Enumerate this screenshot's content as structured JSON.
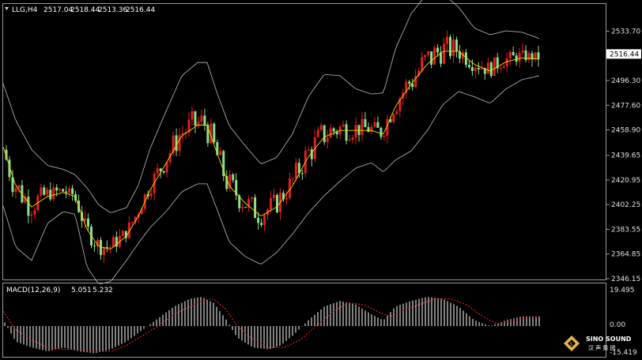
{
  "header": {
    "symbol": "LLG,H4",
    "open": "2517.04",
    "high": "2518.44",
    "low": "2513.36",
    "close": "2516.44"
  },
  "macd": {
    "label": "MACD(12,26,9)",
    "main": "5.051",
    "signal": "5.232",
    "ticks": [
      "19.495",
      "0.00",
      "-15.419"
    ]
  },
  "logo": {
    "name": "SINO SOUND",
    "chinese": "汉 声 集 团"
  },
  "colors": {
    "bull": "#e01f1f",
    "bear": "#8be08b",
    "ma": "#ffd400",
    "band": "#bdbdbd",
    "signal": "#ff2a2a",
    "hist": "#ffffff"
  },
  "chart_data": {
    "type": "candlestick",
    "ylim": [
      2346.15,
      2543.0
    ],
    "yticks": [
      "2533.70",
      "2516.44",
      "2496.30",
      "2477.60",
      "2458.90",
      "2439.65",
      "2420.95",
      "2402.25",
      "2383.55",
      "2364.85",
      "2346.15"
    ],
    "current_price": "2516.44",
    "midline_points": [
      [
        0,
        2455
      ],
      [
        20,
        2418
      ],
      [
        40,
        2402
      ],
      [
        60,
        2410
      ],
      [
        80,
        2413
      ],
      [
        95,
        2410
      ],
      [
        110,
        2385
      ],
      [
        125,
        2372
      ],
      [
        140,
        2370
      ],
      [
        160,
        2380
      ],
      [
        175,
        2395
      ],
      [
        190,
        2415
      ],
      [
        210,
        2435
      ],
      [
        230,
        2456
      ],
      [
        250,
        2464
      ],
      [
        262,
        2464
      ],
      [
        275,
        2442
      ],
      [
        290,
        2418
      ],
      [
        310,
        2405
      ],
      [
        330,
        2395
      ],
      [
        350,
        2402
      ],
      [
        370,
        2418
      ],
      [
        390,
        2440
      ],
      [
        410,
        2455
      ],
      [
        430,
        2460
      ],
      [
        450,
        2460
      ],
      [
        470,
        2460
      ],
      [
        485,
        2457
      ],
      [
        500,
        2478
      ],
      [
        520,
        2495
      ],
      [
        540,
        2510
      ],
      [
        560,
        2520
      ],
      [
        580,
        2520
      ],
      [
        600,
        2510
      ],
      [
        620,
        2505
      ],
      [
        640,
        2512
      ],
      [
        660,
        2515
      ],
      [
        683,
        2514
      ]
    ],
    "band_width_points": [
      [
        0,
        46
      ],
      [
        20,
        48
      ],
      [
        40,
        42
      ],
      [
        60,
        22
      ],
      [
        80,
        16
      ],
      [
        95,
        15
      ],
      [
        110,
        30
      ],
      [
        125,
        30
      ],
      [
        140,
        26
      ],
      [
        160,
        20
      ],
      [
        175,
        22
      ],
      [
        190,
        30
      ],
      [
        210,
        38
      ],
      [
        230,
        44
      ],
      [
        250,
        46
      ],
      [
        262,
        46
      ],
      [
        275,
        44
      ],
      [
        290,
        44
      ],
      [
        310,
        42
      ],
      [
        330,
        38
      ],
      [
        350,
        36
      ],
      [
        370,
        38
      ],
      [
        390,
        44
      ],
      [
        410,
        46
      ],
      [
        430,
        40
      ],
      [
        450,
        30
      ],
      [
        470,
        26
      ],
      [
        485,
        30
      ],
      [
        500,
        42
      ],
      [
        520,
        52
      ],
      [
        540,
        52
      ],
      [
        560,
        42
      ],
      [
        580,
        32
      ],
      [
        600,
        26
      ],
      [
        620,
        26
      ],
      [
        640,
        22
      ],
      [
        660,
        18
      ],
      [
        683,
        14
      ]
    ],
    "ma_offset": -1.5,
    "candle_count": 170,
    "macd_series": {
      "ylim": [
        -15.419,
        19.495
      ],
      "main_points": [
        [
          0,
          6
        ],
        [
          20,
          -8
        ],
        [
          40,
          -11
        ],
        [
          60,
          -13
        ],
        [
          80,
          -11
        ],
        [
          100,
          -13
        ],
        [
          120,
          -14
        ],
        [
          140,
          -12
        ],
        [
          160,
          -8
        ],
        [
          180,
          -2
        ],
        [
          200,
          4
        ],
        [
          220,
          10
        ],
        [
          240,
          14
        ],
        [
          255,
          15
        ],
        [
          270,
          12
        ],
        [
          285,
          4
        ],
        [
          300,
          -6
        ],
        [
          320,
          -11
        ],
        [
          340,
          -12
        ],
        [
          355,
          -10
        ],
        [
          370,
          -5
        ],
        [
          390,
          3
        ],
        [
          410,
          10
        ],
        [
          430,
          13
        ],
        [
          450,
          11
        ],
        [
          470,
          6
        ],
        [
          485,
          3
        ],
        [
          500,
          10
        ],
        [
          520,
          13
        ],
        [
          540,
          15
        ],
        [
          560,
          14
        ],
        [
          580,
          10
        ],
        [
          600,
          3
        ],
        [
          620,
          0
        ],
        [
          640,
          3
        ],
        [
          660,
          5
        ],
        [
          683,
          5
        ]
      ],
      "signal_points": [
        [
          0,
          10
        ],
        [
          20,
          -2
        ],
        [
          40,
          -7
        ],
        [
          60,
          -11
        ],
        [
          80,
          -12
        ],
        [
          100,
          -12
        ],
        [
          120,
          -13
        ],
        [
          140,
          -13
        ],
        [
          160,
          -10
        ],
        [
          180,
          -5
        ],
        [
          200,
          0
        ],
        [
          220,
          6
        ],
        [
          240,
          10
        ],
        [
          255,
          13
        ],
        [
          270,
          14
        ],
        [
          285,
          9
        ],
        [
          300,
          0
        ],
        [
          320,
          -7
        ],
        [
          340,
          -11
        ],
        [
          360,
          -11
        ],
        [
          380,
          -7
        ],
        [
          400,
          0
        ],
        [
          420,
          7
        ],
        [
          440,
          12
        ],
        [
          460,
          11
        ],
        [
          480,
          7
        ],
        [
          495,
          5
        ],
        [
          510,
          8
        ],
        [
          530,
          11
        ],
        [
          550,
          14
        ],
        [
          570,
          14
        ],
        [
          590,
          11
        ],
        [
          610,
          5
        ],
        [
          630,
          1
        ],
        [
          650,
          3
        ],
        [
          683,
          5
        ]
      ]
    }
  }
}
